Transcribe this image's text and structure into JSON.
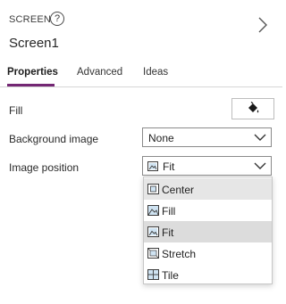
{
  "header": {
    "kind": "SCREEN",
    "help_glyph": "?",
    "name": "Screen1"
  },
  "tabs": [
    {
      "label": "Properties",
      "active": true
    },
    {
      "label": "Advanced",
      "active": false
    },
    {
      "label": "Ideas",
      "active": false
    }
  ],
  "properties": {
    "fill": {
      "label": "Fill"
    },
    "background_image": {
      "label": "Background image",
      "value": "None"
    },
    "image_position": {
      "label": "Image position",
      "value": "Fit"
    }
  },
  "image_position_options": [
    {
      "label": "Center",
      "icon": "image-center-icon",
      "state": "hover"
    },
    {
      "label": "Fill",
      "icon": "image-fill-icon",
      "state": "normal"
    },
    {
      "label": "Fit",
      "icon": "image-fit-icon",
      "state": "selected"
    },
    {
      "label": "Stretch",
      "icon": "image-stretch-icon",
      "state": "normal"
    },
    {
      "label": "Tile",
      "icon": "image-tile-icon",
      "state": "normal"
    }
  ],
  "colors": {
    "accent": "#742774",
    "hover": "#e6e6e6",
    "selected": "#dcdcdc"
  }
}
